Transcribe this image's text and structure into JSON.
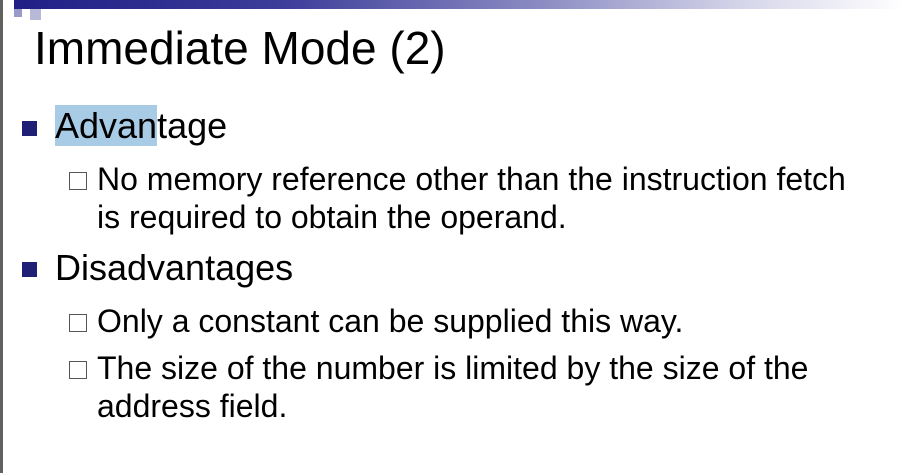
{
  "slide": {
    "title": "Immediate Mode (2)",
    "bullets": [
      {
        "label_highlighted": "Advan",
        "label_rest": "tage",
        "subitems": [
          "No memory reference other than the instruction fetch is required to obtain the operand."
        ]
      },
      {
        "label": "Disadvantages",
        "subitems": [
          "Only a constant can be supplied this way.",
          "The size of the number is limited by the size of the address field."
        ]
      }
    ]
  },
  "colors": {
    "bullet_level1": "#1f1f75",
    "text_highlight": "#a8cbe6",
    "title_bar_start": "#1f1f86"
  }
}
